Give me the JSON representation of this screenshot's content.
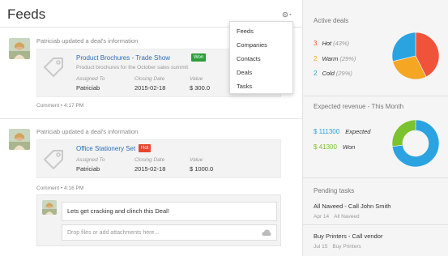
{
  "header": {
    "title": "Feeds",
    "gear_icon": "gear-icon"
  },
  "menu": {
    "items": [
      "Feeds",
      "Companies",
      "Contacts",
      "Deals",
      "Tasks"
    ]
  },
  "feed": [
    {
      "author_line": "Patriciab updated a deal's information",
      "deal_name": "Product Brochures - Trade Show",
      "badge": "Won",
      "badge_color": "#2e9e3a",
      "description": "Product brochures for the October sales summit",
      "assigned_label": "Assigned To",
      "assigned_value": "Patriciab",
      "closing_label": "Closing Date",
      "closing_value": "2015-02-18",
      "value_label": "Value",
      "value_value": "$ 300.0",
      "meta": "Comment  •  4:17 PM"
    },
    {
      "author_line": "Patriciab updated a deal's information",
      "deal_name": "Office Stationery Set",
      "badge": "Hot",
      "badge_color": "#e8452c",
      "description": "",
      "assigned_label": "Assigned To",
      "assigned_value": "Patriciab",
      "closing_label": "Closing Date",
      "closing_value": "2015-02-18",
      "value_label": "Value",
      "value_value": "$ 1000.0",
      "meta": "Comment  •  4:16 PM"
    }
  ],
  "comment": {
    "text": "Lets get cracking and clinch this Deal!",
    "drop_placeholder": "Drop files or add attachments here..."
  },
  "active_deals": {
    "title": "Active deals",
    "items": [
      {
        "count": "3",
        "label": "Hot",
        "pct": "(43%)",
        "color": "#f0533a"
      },
      {
        "count": "2",
        "label": "Warm",
        "pct": "(29%)",
        "color": "#f5a623"
      },
      {
        "count": "2",
        "label": "Cold",
        "pct": "(29%)",
        "color": "#2aa3e0"
      }
    ]
  },
  "expected_revenue": {
    "title": "Expected revenue - This Month",
    "items": [
      {
        "amount": "$ 111300",
        "label": "Expected",
        "color": "#2aa3e0"
      },
      {
        "amount": "$ 41300",
        "label": "Won",
        "color": "#7cc22e"
      }
    ]
  },
  "chart_data": [
    {
      "type": "pie",
      "categories": [
        "Hot",
        "Warm",
        "Cold"
      ],
      "values": [
        43,
        29,
        29
      ],
      "colors": [
        "#f0533a",
        "#f5a623",
        "#2aa3e0"
      ]
    },
    {
      "type": "pie",
      "categories": [
        "Expected",
        "Won"
      ],
      "values": [
        111300,
        41300
      ],
      "colors": [
        "#2aa3e0",
        "#7cc22e"
      ],
      "donut": true
    }
  ],
  "pending_tasks": {
    "title": "Pending tasks",
    "items": [
      {
        "title": "All Naveed - Call John Smith",
        "date": "Apr 14",
        "who": "All Naveed"
      },
      {
        "title": "Buy Printers - Call vendor",
        "date": "Jul 15",
        "who": "Buy Printers"
      }
    ]
  }
}
